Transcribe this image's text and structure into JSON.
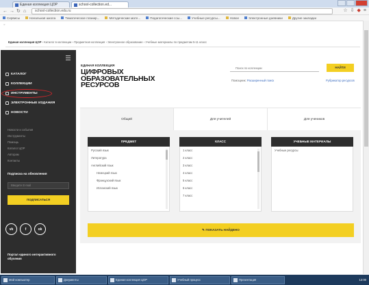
{
  "browser": {
    "tabs": [
      "Единая коллекция ЦОР",
      "school-collection.ed..."
    ],
    "url": "school-collection.edu.ru",
    "bookmarks": [
      "Сервисы",
      "Начальная школа",
      "Тематическое планир...",
      "Методические мате...",
      "Педагогические ссы...",
      "Учебные ресурсы...",
      "Новое",
      "Электронные дневники",
      "Другие закладки"
    ]
  },
  "breadcrumb": {
    "parts": [
      "Единая коллекция ЦОР",
      "Каталог в коллекции",
      "Предметная коллекция",
      "Электронное образование",
      "Учебные материалы по предметам 5-11 класс"
    ]
  },
  "sidebar": {
    "menu": [
      {
        "label": "КАТАЛОГ"
      },
      {
        "label": "КОЛЛЕКЦИИ"
      },
      {
        "label": "ИНСТРУМЕНТЫ"
      },
      {
        "label": "ЭЛЕКТРОННЫЕ ИЗДАНИЯ"
      },
      {
        "label": "НОВОСТИ"
      }
    ],
    "links": [
      "Новости и события",
      "Инструменты",
      "Помощь",
      "Каталог ЦОР",
      "Авторам",
      "Контакты"
    ],
    "subscribe_title": "Подписка на обновления",
    "subscribe_placeholder": "Введите E-mail",
    "subscribe_button": "ПОДПИСАТЬСЯ",
    "socials": [
      "vk",
      "f",
      "ok"
    ],
    "footer": "Портал единого интерактивного обучения"
  },
  "header": {
    "kicker": "ЕДИНАЯ КОЛЛЕКЦИЯ",
    "title": "ЦИФРОВЫХ\nОБРАЗОВАТЕЛЬНЫХ\nРЕСУРСОВ",
    "search_placeholder": "Поиск по коллекции",
    "search_button": "НАЙТИ",
    "advanced_prefix": "Помощник:",
    "advanced_link": "Расширенный поиск",
    "rubricator": "Рубрикатор ресурсов"
  },
  "tabs": [
    "Общий",
    "Для учителей",
    "Для учеников"
  ],
  "columns": {
    "subject": {
      "heading": "ПРЕДМЕТ",
      "items": [
        "Русский язык",
        "Литература",
        "Английский язык",
        "Немецкий язык",
        "Французский язык",
        "Испанский язык"
      ]
    },
    "grade": {
      "heading": "КЛАСС",
      "items": [
        "1 класс",
        "2 класс",
        "3 класс",
        "4 класс",
        "5 класс",
        "6 класс",
        "7 класс"
      ]
    },
    "materials": {
      "heading": "УЧЕБНЫЕ МАТЕРИАЛЫ",
      "items": [
        "Учебные ресурсы"
      ]
    }
  },
  "show_button": "ПОКАЗАТЬ НАЙДЕНО",
  "taskbar": {
    "items": [
      "Мой компьютер",
      "Документы",
      "Единая коллекция ЦОР",
      "Учебный процесс",
      "Презентация"
    ],
    "clock": "12:00"
  }
}
